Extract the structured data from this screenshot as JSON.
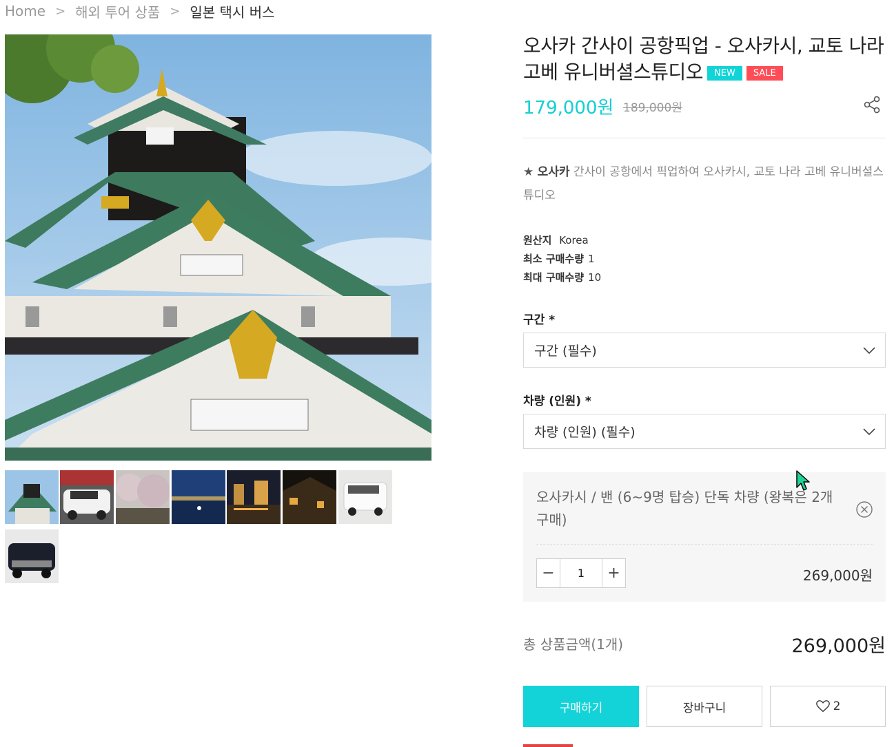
{
  "breadcrumb": {
    "home": "Home",
    "category": "해외 투어 상품",
    "current": "일본 택시 버스",
    "separator": ">"
  },
  "product": {
    "title": "오사카 간사이 공항픽업 - 오사카시, 교토 나라 고베 유니버셜스튜디오",
    "badge_new": "NEW",
    "badge_sale": "SALE",
    "price": "179,000원",
    "original_price": "189,000원",
    "summary_star": "★",
    "summary_bold": "오사카",
    "summary_text": "간사이 공항에서 픽업하여 오사카시, 교토 나라 고베 유니버셜스튜디오",
    "meta": {
      "origin_label": "원산지",
      "origin_value": "Korea",
      "min_label": "최소 구매수량",
      "min_value": "1",
      "max_label": "최대 구매수량",
      "max_value": "10"
    }
  },
  "options": {
    "section_label": "구간 *",
    "section_value": "구간 (필수)",
    "vehicle_label": "차량 (인원) *",
    "vehicle_value": "차량 (인원) (필수)"
  },
  "selected_item": {
    "name": "오사카시 / 밴 (6~9명 탑승) 단독 차량 (왕복은 2개 구매)",
    "quantity": "1",
    "minus": "−",
    "plus": "+",
    "price": "269,000원"
  },
  "total": {
    "label": "총 상품금액(1개)",
    "price": "269,000원"
  },
  "actions": {
    "buy": "구매하기",
    "cart": "장바구니",
    "wish_count": "2"
  },
  "colors": {
    "accent": "#13cfd4",
    "sale": "#ff4d57",
    "new": "#11d4d8"
  },
  "thumbnails": [
    "castle",
    "white-minivan",
    "cherry-blossom-park",
    "night-harbor",
    "night-waterfront",
    "night-street",
    "white-van",
    "black-minivan"
  ]
}
